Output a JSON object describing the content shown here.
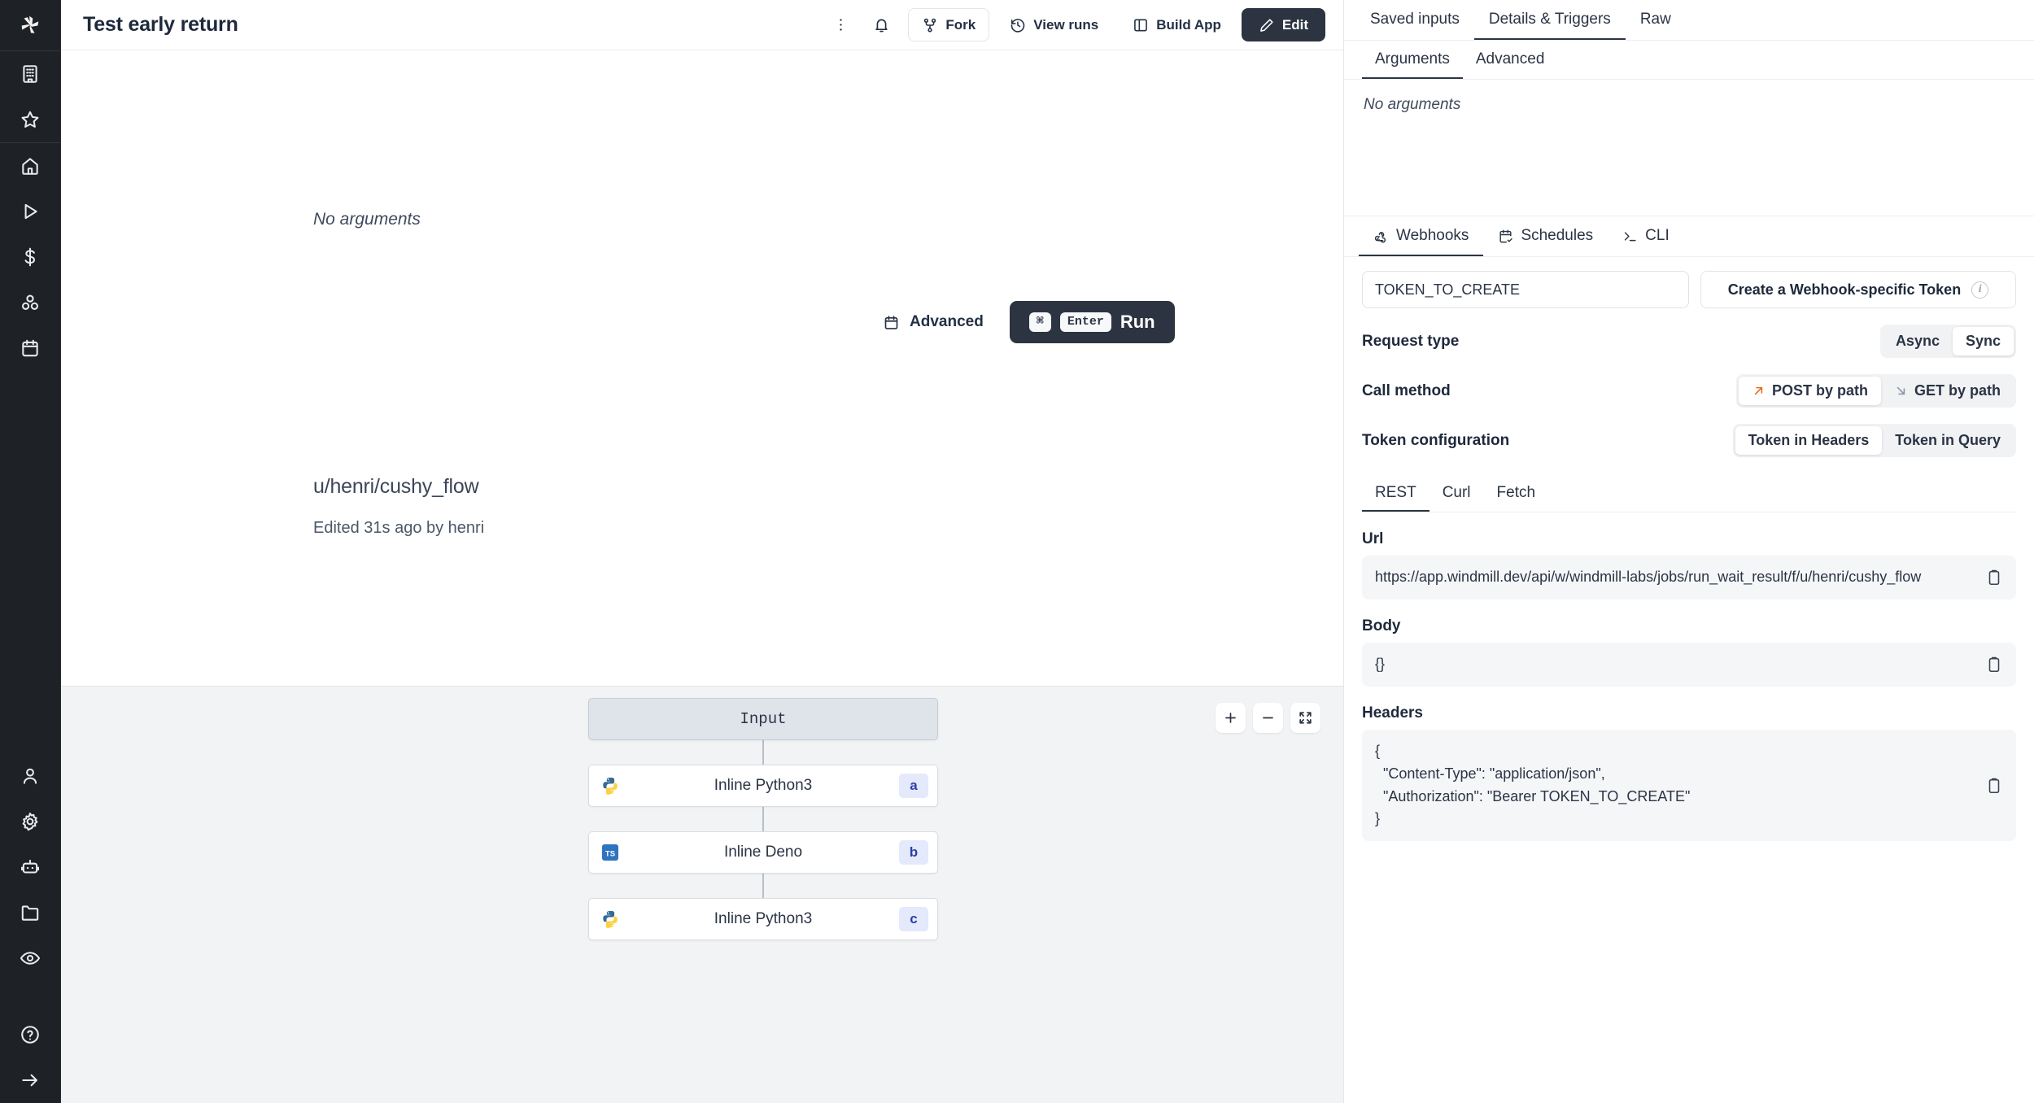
{
  "app": {
    "logo_name": "windmill-logo"
  },
  "sidebar": {
    "groups": [
      {
        "items": [
          {
            "name": "sidebar-item-workspace",
            "icon": "building-icon"
          },
          {
            "name": "sidebar-item-favorites",
            "icon": "star-icon"
          }
        ]
      },
      {
        "items": [
          {
            "name": "sidebar-item-home",
            "icon": "home-icon"
          },
          {
            "name": "sidebar-item-runs",
            "icon": "play-icon"
          },
          {
            "name": "sidebar-item-variables",
            "icon": "dollar-icon"
          },
          {
            "name": "sidebar-item-resources",
            "icon": "cubes-icon"
          },
          {
            "name": "sidebar-item-schedules",
            "icon": "calendar-icon"
          }
        ]
      },
      {
        "items": [
          {
            "name": "sidebar-item-workers",
            "icon": "user-icon"
          },
          {
            "name": "sidebar-item-settings",
            "icon": "gear-icon"
          },
          {
            "name": "sidebar-item-ai",
            "icon": "robot-icon"
          },
          {
            "name": "sidebar-item-folders",
            "icon": "folder-icon"
          },
          {
            "name": "sidebar-item-audit-logs",
            "icon": "eye-icon"
          }
        ]
      },
      {
        "items": [
          {
            "name": "sidebar-item-help",
            "icon": "question-circle-icon"
          },
          {
            "name": "sidebar-item-collapse",
            "icon": "arrow-right-icon"
          }
        ]
      }
    ]
  },
  "topbar": {
    "title": "Test early return",
    "more_label": "",
    "notifications_label": "",
    "fork_label": "Fork",
    "view_runs_label": "View runs",
    "build_app_label": "Build App",
    "edit_label": "Edit"
  },
  "main": {
    "no_arguments": "No arguments",
    "advanced_label": "Advanced",
    "run_label": "Run",
    "kbd_meta": "⌘",
    "kbd_enter": "Enter",
    "flow_path": "u/henri/cushy_flow",
    "edited_text": "Edited 31s ago by henri"
  },
  "flow": {
    "zoom_in_label": "+",
    "zoom_out_label": "−",
    "nodes": [
      {
        "label": "Input",
        "badge": "",
        "icon": "none",
        "type": "input"
      },
      {
        "label": "Inline Python3",
        "badge": "a",
        "icon": "python-icon",
        "type": "step"
      },
      {
        "label": "Inline Deno",
        "badge": "b",
        "icon": "typescript-icon",
        "type": "step"
      },
      {
        "label": "Inline Python3",
        "badge": "c",
        "icon": "python-icon",
        "type": "step"
      }
    ]
  },
  "right_panel": {
    "top_tabs": [
      {
        "label": "Saved inputs",
        "active": false
      },
      {
        "label": "Details & Triggers",
        "active": true
      },
      {
        "label": "Raw",
        "active": false
      }
    ],
    "sub_tabs": [
      {
        "label": "Arguments",
        "active": true
      },
      {
        "label": "Advanced",
        "active": false
      }
    ],
    "no_arguments": "No arguments",
    "trigger_tabs": [
      {
        "label": "Webhooks",
        "icon": "webhook-icon",
        "active": true
      },
      {
        "label": "Schedules",
        "icon": "calendar-check-icon",
        "active": false
      },
      {
        "label": "CLI",
        "icon": "terminal-icon",
        "active": false
      }
    ],
    "token_value": "TOKEN_TO_CREATE",
    "token_placeholder": "TOKEN_TO_CREATE",
    "create_token_label": "Create a Webhook-specific Token",
    "info_glyph": "i",
    "request_type": {
      "label": "Request type",
      "options": [
        {
          "label": "Async",
          "active": false
        },
        {
          "label": "Sync",
          "active": true
        }
      ]
    },
    "call_method": {
      "label": "Call method",
      "options": [
        {
          "label": "POST by path",
          "active": true,
          "icon": "arrow-up-right-icon"
        },
        {
          "label": "GET by path",
          "active": false,
          "icon": "arrow-down-right-icon"
        }
      ]
    },
    "token_configuration": {
      "label": "Token configuration",
      "options": [
        {
          "label": "Token in Headers",
          "active": true
        },
        {
          "label": "Token in Query",
          "active": false
        }
      ]
    },
    "code_tabs": [
      {
        "label": "REST",
        "active": true
      },
      {
        "label": "Curl",
        "active": false
      },
      {
        "label": "Fetch",
        "active": false
      }
    ],
    "url_label": "Url",
    "url_value": "https://app.windmill.dev/api/w/windmill-labs/jobs/run_wait_result/f/u/henri/cushy_flow",
    "body_label": "Body",
    "body_value": "{}",
    "headers_label": "Headers",
    "headers_value": "{\n  \"Content-Type\": \"application/json\",\n  \"Authorization\": \"Bearer TOKEN_TO_CREATE\"\n}"
  },
  "colors": {
    "accent_dark": "#2c3442",
    "rail_bg": "#1e2125",
    "canvas_bg": "#f1f3f5",
    "badge_bg": "#e4e9fb",
    "badge_fg": "#2c3fa8",
    "post_arrow": "#ea6a1e"
  }
}
